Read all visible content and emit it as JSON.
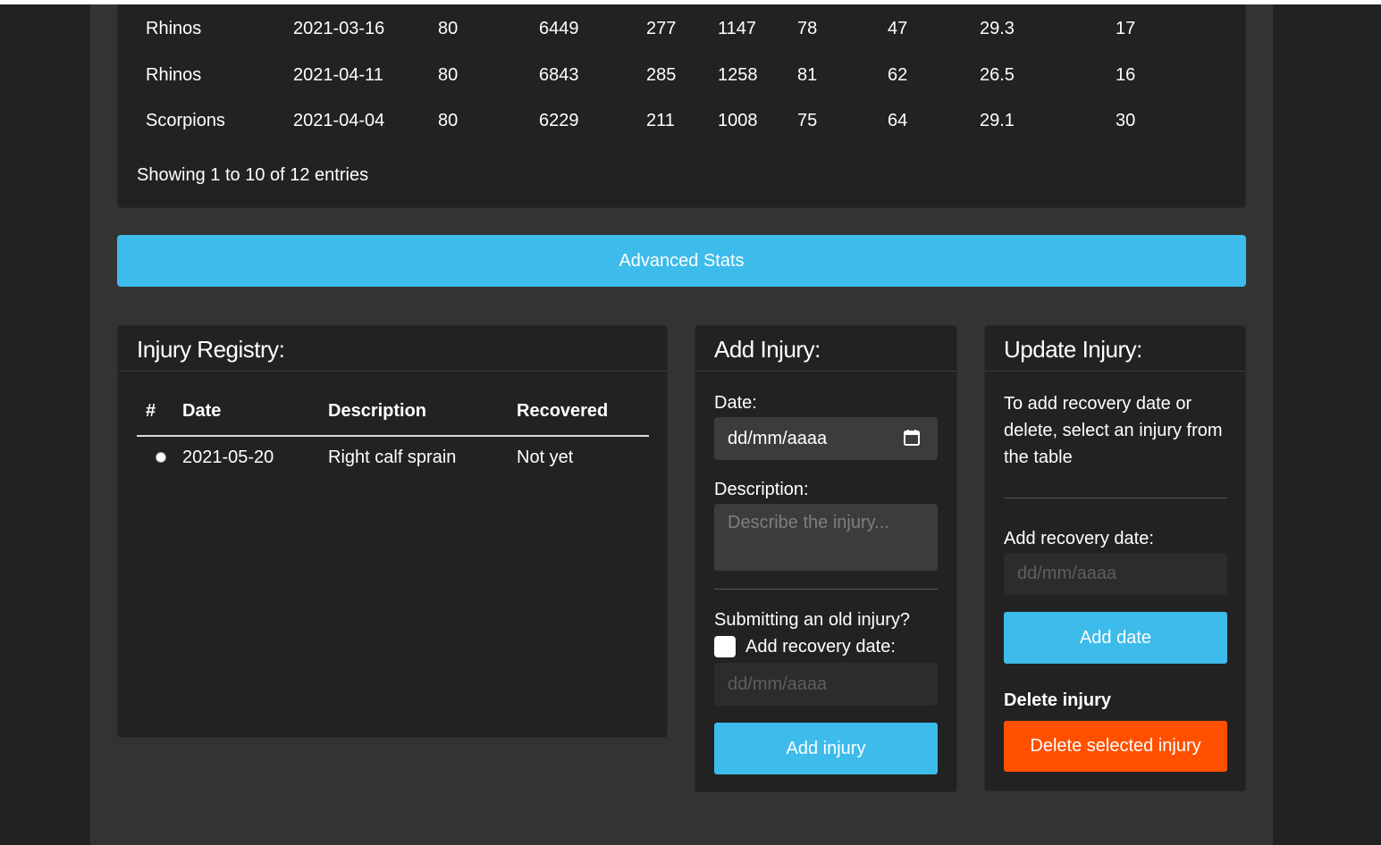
{
  "stats_table": {
    "rows": [
      [
        "Rhinos",
        "2021-03-16",
        "80",
        "6449",
        "277",
        "1147",
        "78",
        "47",
        "29.3",
        "17"
      ],
      [
        "Rhinos",
        "2021-04-11",
        "80",
        "6843",
        "285",
        "1258",
        "81",
        "62",
        "26.5",
        "16"
      ],
      [
        "Scorpions",
        "2021-04-04",
        "80",
        "6229",
        "211",
        "1008",
        "75",
        "64",
        "29.1",
        "30"
      ]
    ],
    "entries_info": "Showing 1 to 10 of 12 entries"
  },
  "advanced_stats_label": "Advanced Stats",
  "registry": {
    "title": "Injury Registry:",
    "headers": [
      "#",
      "Date",
      "Description",
      "Recovered"
    ],
    "rows": [
      {
        "date": "2021-05-20",
        "description": "Right calf sprain",
        "recovered": "Not yet"
      }
    ]
  },
  "add_injury": {
    "title": "Add Injury:",
    "date_label": "Date:",
    "date_value": "dd/mm/aaaa",
    "description_label": "Description:",
    "description_placeholder": "Describe the injury...",
    "old_injury_label": "Submitting an old injury?",
    "recovery_checkbox_label": "Add recovery date:",
    "recovery_date_value": "dd/mm/aaaa",
    "submit_label": "Add injury"
  },
  "update_injury": {
    "title": "Update Injury:",
    "help_text": "To add recovery date or delete, select an injury from the table",
    "recovery_label": "Add recovery date:",
    "recovery_date_value": "dd/mm/aaaa",
    "add_date_label": "Add date",
    "delete_heading": "Delete injury",
    "delete_label": "Delete selected injury"
  },
  "colors": {
    "accent_blue": "#3dbbeb",
    "danger_orange": "#ff5000",
    "card_bg": "#222222",
    "page_bg": "#333333"
  }
}
